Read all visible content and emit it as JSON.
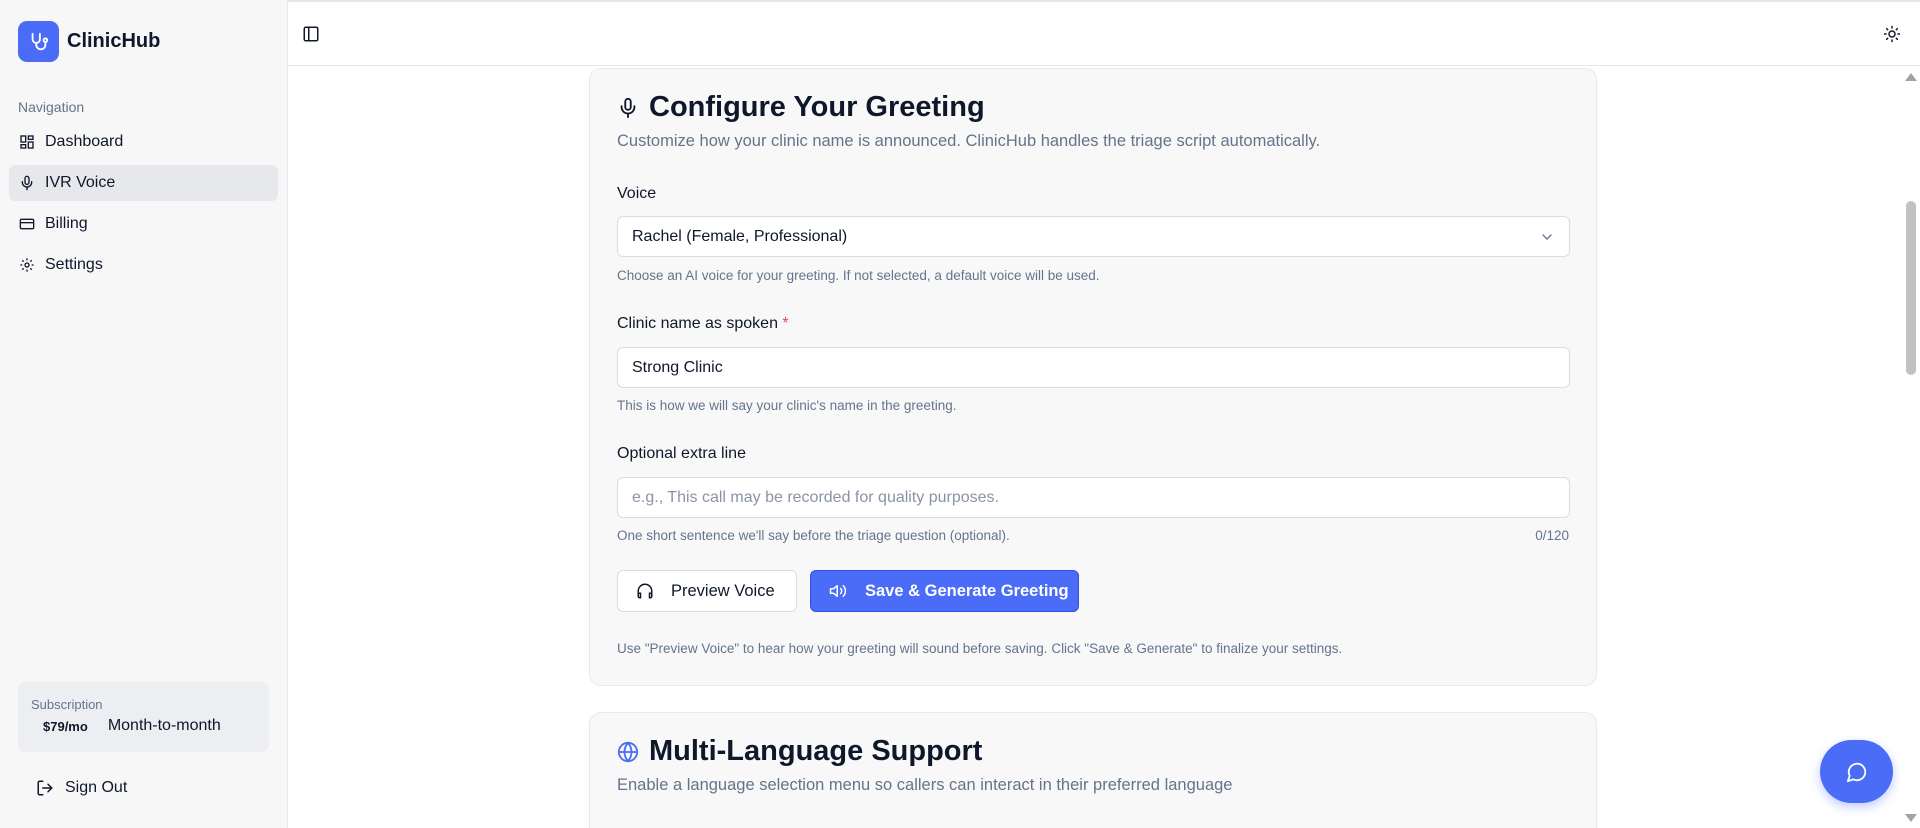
{
  "brand": {
    "name": "ClinicHub",
    "accent": "#4a6cf7"
  },
  "sidebar": {
    "heading": "Navigation",
    "items": [
      {
        "label": "Dashboard",
        "icon": "dashboard-icon",
        "active": false
      },
      {
        "label": "IVR Voice",
        "icon": "microphone-icon",
        "active": true
      },
      {
        "label": "Billing",
        "icon": "credit-card-icon",
        "active": false
      },
      {
        "label": "Settings",
        "icon": "gear-icon",
        "active": false
      }
    ],
    "subscription": {
      "label": "Subscription",
      "price": "$79/mo",
      "plan": "Month-to-month"
    },
    "sign_out": "Sign Out"
  },
  "topbar": {
    "toggle_icon": "sidebar-toggle-icon",
    "theme_icon": "sun-icon"
  },
  "greeting": {
    "title": "Configure Your Greeting",
    "subtitle": "Customize how your clinic name is announced. ClinicHub handles the triage script automatically.",
    "voice": {
      "label": "Voice",
      "value": "Rachel (Female, Professional)",
      "help": "Choose an AI voice for your greeting. If not selected, a default voice will be used."
    },
    "clinic_name": {
      "label": "Clinic name as spoken",
      "required_mark": "*",
      "value": "Strong Clinic",
      "help": "This is how we will say your clinic's name in the greeting."
    },
    "extra_line": {
      "label": "Optional extra line",
      "placeholder": "e.g., This call may be recorded for quality purposes.",
      "help": "One short sentence we'll say before the triage question (optional).",
      "counter": "0/120"
    },
    "preview_button": "Preview Voice",
    "save_button": "Save & Generate Greeting",
    "note": "Use \"Preview Voice\" to hear how your greeting will sound before saving. Click \"Save & Generate\" to finalize your settings."
  },
  "multilang": {
    "title": "Multi-Language Support",
    "subtitle": "Enable a language selection menu so callers can interact in their preferred language"
  }
}
